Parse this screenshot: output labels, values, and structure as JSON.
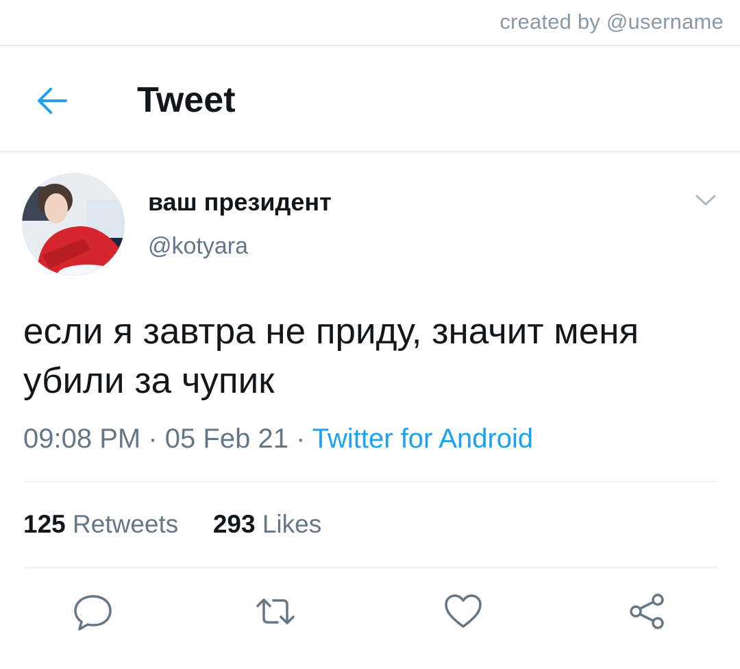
{
  "watermark": "created by @username",
  "header": {
    "title": "Tweet",
    "back_icon": "arrow-left-icon"
  },
  "author": {
    "display_name": "ваш президент",
    "handle": "@kotyara",
    "avatar": "profile-photo"
  },
  "tweet": {
    "text": "если я завтра не приду, значит меня убили за чупик",
    "time": "09:08 PM",
    "separator": "·",
    "date": "05 Feb 21",
    "source": "Twitter for Android"
  },
  "stats": {
    "retweets_count": "125",
    "retweets_label": "Retweets",
    "likes_count": "293",
    "likes_label": "Likes"
  },
  "actions": [
    "reply-icon",
    "retweet-icon",
    "like-icon",
    "share-icon"
  ],
  "colors": {
    "accent": "#1da1f2",
    "secondary_text": "#657786",
    "divider": "#e1e8ed"
  }
}
